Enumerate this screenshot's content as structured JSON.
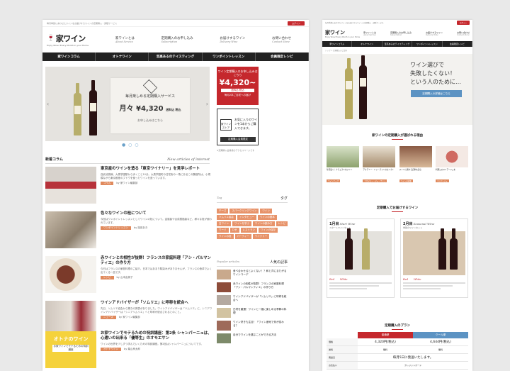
{
  "left": {
    "topbar": {
      "tagline": "毎月季節にあわせたワインをお届けするワインの定期購入・通販サービス",
      "login": "ログイン"
    },
    "logo": {
      "main": "家ワイン",
      "sub": "Enjoy Wine! Every Month in your Home"
    },
    "nav": [
      {
        "label": "家ワインとは",
        "en": "About Service"
      },
      {
        "label": "定期購入のお申し込み",
        "en": "Subscription"
      },
      {
        "label": "お届けするワイン",
        "en": "Delivery Wine"
      },
      {
        "label": "お問い合わせ",
        "en": "Contact Store"
      }
    ],
    "darknav": [
      "家ワインコラム",
      "オトナワイン",
      "至高あるのテイスティング",
      "ワンポイントレッスン",
      "会員限定レシピ"
    ],
    "hero": {
      "subtitle": "毎月楽しめる定期購入サービス",
      "price": "月々 ¥4,320",
      "price_note": "送料込 税込",
      "footer": "お申し込みはこちら"
    },
    "banner1": {
      "top": "ワイン定期購入のお申し込みはこちら",
      "price": "¥4,320~",
      "sub": "送料込 税込",
      "foot": "毎月2本ご自宅へお届け"
    },
    "banner2": {
      "store": "家ワインストア",
      "text": "お気に入りのワインを1本からご購入できます。",
      "button": "定期購入会員限定"
    },
    "sidenote": "※定期購入会員様のアクセスページです",
    "columns": {
      "heading": "新着コラム",
      "en": "New articles of interest"
    },
    "articles": [
      {
        "title": "東京産のワインを造る「東京ワイナリー」を見学レポート",
        "desc": "西武池袋線、大泉学園駅から歩くこと10分。大泉学園町の住宅街の一角にあるこの醸造所は、小規模ながら東京都産のブドウを使ったワインを造っています。",
        "tag": "コラム",
        "author": "by 家ワイン編集部"
      },
      {
        "title": "色々なワインの栓について",
        "desc": "今回はワンポイントレッスンとしてワインの栓について。金属製や合成樹脂製など、様々な栓が使われています。",
        "tag": "ワンポイントレッスン",
        "author": "by 柴田あき"
      },
      {
        "title": "赤ワインとの相性が抜群！フランスの家庭料理「アシ・パルマンティエ」の作り方",
        "desc": "今日はフランスの家庭料理のご紹介。日本ではあまり馴染みがありませんが、フランスの食卓でよく出てくる一品です。",
        "tag": "レシピ",
        "author": "by 山本由美子"
      },
      {
        "title": "ワインアドバイザーが「ソムリエ」に呼称を統合へ",
        "desc": "先日、ソムリエ協会から驚きの発表がありました。ワインアドバイザーは「ソムリエ」に、シニアワインアドバイザーは「シニアソムリエ」へと呼称が統合されるとのこと。",
        "tag": "ニュース",
        "author": "by 家ワイン編集部"
      },
      {
        "title": "お家ワインでモテるための特訓講座：第2条 シャンパーニュは、心遣いの出来る「優等生」のオモエサン",
        "desc": "ワインの世界を少しずつ学んでいくための特訓講座。第2回はシャンパーニュについてです。",
        "tag": "オトナワイン",
        "author": "by 葉山孝太郎"
      }
    ],
    "thumb5": {
      "title": "オトナのワイン",
      "sub": "お家ワインでモテるための特訓講座"
    },
    "tagbox": {
      "heading": "Tag",
      "label": "タグ"
    },
    "tags": [
      "チーズ",
      "スパークリングワイン",
      "ワイン",
      "ソムリエ協会",
      "インタビュー",
      "ワインの基本",
      "白ワイン",
      "ワインを学ぶ",
      "ワインの飲み方",
      "レシピ",
      "ワード",
      "ロゼ",
      "レストラン",
      "ワインの保存",
      "ワインの栓",
      "パーティー",
      "ワイナリー"
    ],
    "popbox": {
      "heading": "Popular articles",
      "label": "人気の記事"
    },
    "popular": [
      "食べ合わせるとよくない！？和と洋にまたがるワインコーデ",
      "赤ワインの相性が抜群！フランスの家庭料理「アシ・パルマンティエ」の作り方",
      "ワインアドバイザーが「ソムリエ」に呼称を統合へ",
      "白材を厳選！ワインと一緒に楽しめる季節の料理",
      "ワイン好きも注目！「ワイン産地で何が変わる？",
      "自分でワインを選ぶことができる方法"
    ]
  },
  "right": {
    "topbar": {
      "tagline": "毎月季節にあわせたワインをお届けするワインの定期購入・通販サービス",
      "login": "ログイン"
    },
    "logo": {
      "main": "家ワイン",
      "sub": "Enjoy Wine! Every Month in your Home"
    },
    "nav": [
      {
        "label": "家ワインとは",
        "en": "About Service"
      },
      {
        "label": "定期購入のお申し込み",
        "en": "Subscription"
      },
      {
        "label": "お届けするワイン",
        "en": "Delivery Wine"
      },
      {
        "label": "お問い合わせ",
        "en": "Contact Store"
      }
    ],
    "darknav": [
      "家ワインコラム",
      "オトナワイン",
      "至高あるのテイスティング",
      "ワンポイントレッスン",
      "会員限定レシピ"
    ],
    "breadcrumb": "トップ > 定期購入のご案内",
    "hero": {
      "line1": "ワイン選びで",
      "line2": "失敗したくない！",
      "line3": "という人のために…",
      "button": "定期購入の詳細はこちら"
    },
    "reasons_title": "家ワインの定期購入が選ばれる理由",
    "reasons": [
      {
        "title": "毎月届く！ナチュラルなワイン",
        "tag": "ラインアップ"
      },
      {
        "title": "アカデミー・ドゥ・ヴァンのセレクト",
        "tag": "アカデミー・デュ・ヴァン"
      },
      {
        "title": "ワインに関する記事を読む",
        "tag": "ワインの知識"
      },
      {
        "title": "料理とのマリアージュを",
        "tag": "マリアージュ"
      }
    ],
    "wines_title": "定期購入でお届けするワイン",
    "wines": [
      {
        "month": "1月目",
        "en": "Start Wine",
        "ja": "スタートワインセット",
        "red": "Red",
        "white": "White"
      },
      {
        "month": "2月目",
        "en": "Seasonal Wine",
        "ja": "季節のワインセット",
        "red": "Red",
        "white": "White"
      }
    ],
    "plan": {
      "title": "定期購入のプラン",
      "col1": "普通便",
      "col2": "クール便",
      "rows": [
        {
          "label": "価格",
          "v1": "4,320円(税込)",
          "v2": "4,644円(税込)"
        },
        {
          "label": "送料",
          "v1": "無料",
          "v2": "無料"
        },
        {
          "label": "発送日",
          "v1": "毎月5日に発送いたします。",
          "v2": ""
        },
        {
          "label": "お支払い",
          "v1": "クレジットカード",
          "v2": ""
        }
      ]
    }
  },
  "colors": {
    "accent_red": "#c5282d",
    "tag_orange": "#e7936a",
    "button_blue": "#5c93c3",
    "nav_dark": "#222222"
  }
}
